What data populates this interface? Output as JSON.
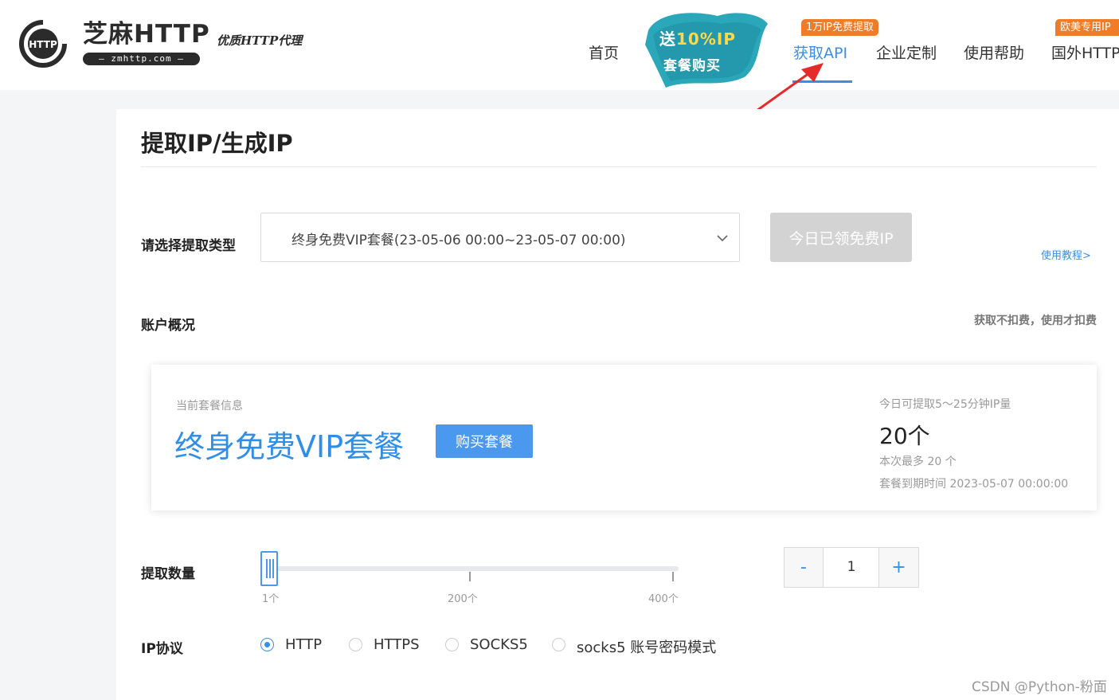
{
  "header": {
    "logo": {
      "mark_text": "HTTP",
      "brand": "芝麻HTTP",
      "slogan": "优质HTTP代理",
      "domain": "— zmhttp.com —"
    },
    "promo": {
      "line1_prefix": "送",
      "line1_highlight": "10%IP",
      "line2": "套餐购买"
    },
    "nav": [
      {
        "label": "首页",
        "active": false
      },
      {
        "label": "获取API",
        "active": true,
        "badge": "1万IP免费提取"
      },
      {
        "label": "企业定制",
        "active": false
      },
      {
        "label": "使用帮助",
        "active": false
      },
      {
        "label": "国外HTTP",
        "active": false,
        "badge": "欧美专用IP"
      }
    ],
    "accent": "#3a8ee6",
    "badge_color": "#f07c28"
  },
  "page": {
    "title": "提取IP/生成IP",
    "extract_type": {
      "label": "请选择提取类型",
      "selected": "终身免费VIP套餐(23-05-06 00:00~23-05-07 00:00)",
      "button": "今日已领免费IP",
      "tutorial_link": "使用教程>"
    },
    "account": {
      "label": "账户概况",
      "hint": "获取不扣费，使用才扣费"
    },
    "card": {
      "subtitle": "当前套餐信息",
      "plan_name": "终身免费VIP套餐",
      "buy_button": "购买套餐",
      "right_title": "今日可提取5～25分钟IP量",
      "count": "20个",
      "max": "本次最多 20 个",
      "expire": "套餐到期时间 2023-05-07 00:00:00"
    },
    "quantity": {
      "label": "提取数量",
      "slider_min": 1,
      "slider_max": 400,
      "slider_value": 1,
      "ticks": [
        "1个",
        "200个",
        "400个"
      ],
      "minus": "-",
      "value": "1",
      "plus": "+"
    },
    "protocol": {
      "label": "IP协议",
      "options": [
        {
          "label": "HTTP",
          "checked": true
        },
        {
          "label": "HTTPS",
          "checked": false
        },
        {
          "label": "SOCKS5",
          "checked": false
        },
        {
          "label": "socks5 账号密码模式",
          "checked": false
        }
      ]
    }
  },
  "watermark": "CSDN @Python-粉面"
}
